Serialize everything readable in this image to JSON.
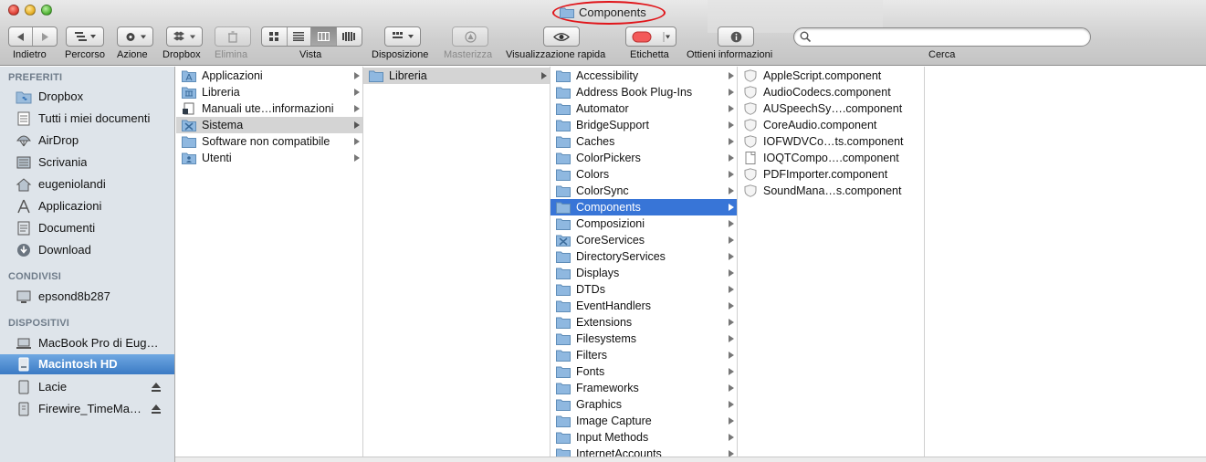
{
  "window": {
    "title": "Components",
    "colors": {
      "selection": "#3875d7",
      "sidebar_bg": "#dee4ea",
      "title_highlight": "#e0151a"
    }
  },
  "toolbar": {
    "back_label": "Indietro",
    "path_label": "Percorso",
    "action_label": "Azione",
    "dropbox_label": "Dropbox",
    "delete_label": "Elimina",
    "view_label": "Vista",
    "arrange_label": "Disposizione",
    "burn_label": "Masterizza",
    "quicklook_label": "Visualizzazione rapida",
    "tag_label": "Etichetta",
    "info_label": "Ottieni informazioni",
    "search_label": "Cerca",
    "search_value": ""
  },
  "sidebar": {
    "favorites_header": "PREFERITI",
    "favorites": [
      {
        "label": "Dropbox",
        "icon": "dropbox-folder-icon"
      },
      {
        "label": "Tutti i miei documenti",
        "icon": "all-documents-icon"
      },
      {
        "label": "AirDrop",
        "icon": "airdrop-icon"
      },
      {
        "label": "Scrivania",
        "icon": "desktop-icon"
      },
      {
        "label": "eugeniolandi",
        "icon": "home-icon"
      },
      {
        "label": "Applicazioni",
        "icon": "applications-icon"
      },
      {
        "label": "Documenti",
        "icon": "documents-icon"
      },
      {
        "label": "Download",
        "icon": "download-icon"
      }
    ],
    "shared_header": "CONDIVISI",
    "shared": [
      {
        "label": "epsond8b287",
        "icon": "network-display-icon"
      }
    ],
    "devices_header": "DISPOSITIVI",
    "devices": [
      {
        "label": "MacBook Pro di Eug…",
        "icon": "laptop-icon",
        "selected": false
      },
      {
        "label": "Macintosh HD",
        "icon": "hard-drive-icon",
        "selected": true
      },
      {
        "label": "Lacie",
        "icon": "external-drive-icon",
        "selected": false,
        "ejectable": true
      },
      {
        "label": "Firewire_TimeMa…",
        "icon": "external-drive-icon",
        "selected": false,
        "ejectable": true
      }
    ]
  },
  "columns": {
    "col1": [
      {
        "label": "Applicazioni",
        "state": "normal"
      },
      {
        "label": "Libreria",
        "state": "normal"
      },
      {
        "label": "Manuali ute…informazioni",
        "state": "normal"
      },
      {
        "label": "Sistema",
        "state": "path"
      },
      {
        "label": "Software non compatibile",
        "state": "normal"
      },
      {
        "label": "Utenti",
        "state": "normal"
      }
    ],
    "col2": [
      {
        "label": "Libreria",
        "state": "path"
      }
    ],
    "col3": [
      "Accessibility",
      "Address Book Plug-Ins",
      "Automator",
      "BridgeSupport",
      "Caches",
      "ColorPickers",
      "Colors",
      "ColorSync",
      "Components",
      "Composizioni",
      "CoreServices",
      "DirectoryServices",
      "Displays",
      "DTDs",
      "EventHandlers",
      "Extensions",
      "Filesystems",
      "Filters",
      "Fonts",
      "Frameworks",
      "Graphics",
      "Image Capture",
      "Input Methods",
      "InternetAccounts"
    ],
    "col3_selected": "Components",
    "col4": [
      {
        "label": "AppleScript.component",
        "icon": "component-shield-icon"
      },
      {
        "label": "AudioCodecs.component",
        "icon": "component-shield-icon"
      },
      {
        "label": "AUSpeechSy….component",
        "icon": "component-shield-icon"
      },
      {
        "label": "CoreAudio.component",
        "icon": "component-shield-icon"
      },
      {
        "label": "IOFWDVCo…ts.component",
        "icon": "component-shield-icon"
      },
      {
        "label": "IOQTCompo….component",
        "icon": "document-icon"
      },
      {
        "label": "PDFImporter.component",
        "icon": "component-shield-icon"
      },
      {
        "label": "SoundMana…s.component",
        "icon": "component-shield-icon"
      }
    ]
  }
}
